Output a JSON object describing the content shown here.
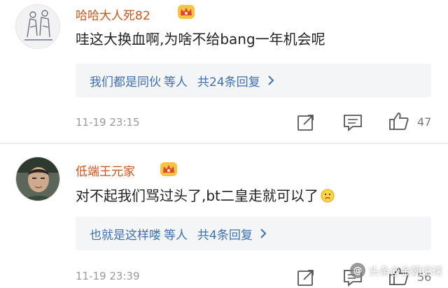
{
  "comments": [
    {
      "username": "哈哈大人死82",
      "content": "哇这大换血啊,为啥不给bang一年机会呢",
      "reply": {
        "users": "我们都是同伙",
        "mid": "等人",
        "count": "共24条回复"
      },
      "time": "11-19 23:15",
      "likes": "47"
    },
    {
      "username": "低端王元家",
      "content": "对不起我们骂过头了,bt二皇走就可以了",
      "reply": {
        "users": "也就是这样喽",
        "mid": "等人",
        "count": "共4条回复"
      },
      "time": "11-19 23:39",
      "likes": "56"
    }
  ],
  "watermark": {
    "logo": "@",
    "text": "头条@金朝说球"
  },
  "colors": {
    "username": "#c8541d",
    "link": "#3e6fae",
    "reply_bg": "#f4f5f7",
    "muted": "#9a9a9a"
  },
  "icons": [
    "crown-badge-icon",
    "share-icon",
    "comment-icon",
    "thumbs-up-icon",
    "chevron-right-icon",
    "emoji-face-icon"
  ]
}
